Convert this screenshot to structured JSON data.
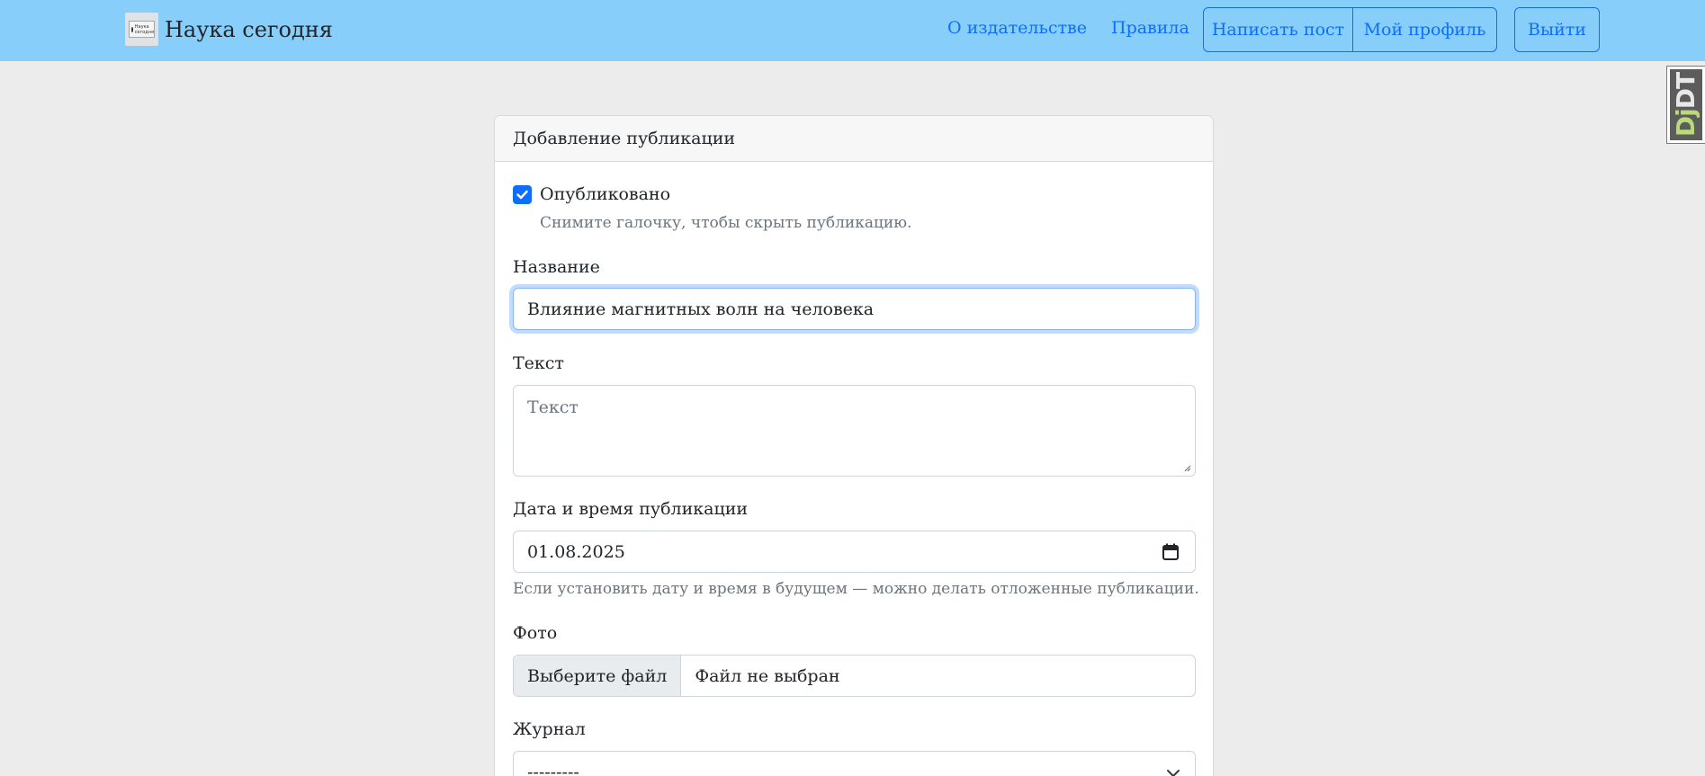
{
  "navbar": {
    "brand": "Наука сегодня",
    "logo_icon": "journal-logo-icon",
    "links": [
      "О издательстве",
      "Правила"
    ],
    "write_post": "Написать пост",
    "profile": "Мой профиль",
    "logout": "Выйти",
    "bg_color": "#87cefa",
    "accent": "#0d6efd"
  },
  "debug_toolbar": {
    "label_dj": "Dj",
    "label_dt": "DT"
  },
  "form": {
    "header": "Добавление публикации",
    "published": {
      "label": "Опубликовано",
      "checked": true,
      "help": "Снимите галочку, чтобы скрыть публикацию."
    },
    "title": {
      "label": "Название",
      "value": "Влияние магнитных волн на человека"
    },
    "text": {
      "label": "Текст",
      "placeholder": "Текст"
    },
    "pub_date": {
      "label": "Дата и время публикации",
      "value": "01.08.2025",
      "help": "Если установить дату и время в будущем — можно делать отложенные публикации."
    },
    "photo": {
      "label": "Фото",
      "button": "Выберите файл",
      "status": "Файл не выбран"
    },
    "journal": {
      "label": "Журнал",
      "value": "---------"
    }
  }
}
